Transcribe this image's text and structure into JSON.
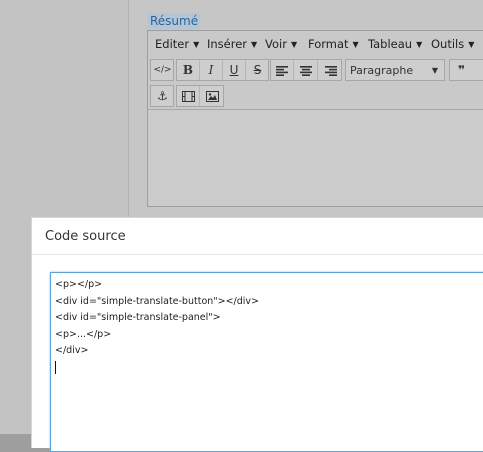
{
  "field": {
    "label": "Résumé"
  },
  "menubar": [
    {
      "label": "Editer",
      "icon": "caret-down"
    },
    {
      "label": "Insérer",
      "icon": "caret-down"
    },
    {
      "label": "Voir",
      "icon": "caret-down"
    },
    {
      "label": "Format",
      "icon": "caret-down"
    },
    {
      "label": "Tableau",
      "icon": "caret-down"
    },
    {
      "label": "Outils",
      "icon": "caret-down"
    }
  ],
  "toolbar": {
    "source_code_glyph": "</>",
    "bold_glyph": "B",
    "italic_glyph": "I",
    "underline_glyph": "U",
    "strikethrough_glyph": "S",
    "format_select": "Paragraphe",
    "blockquote_glyph": "❞",
    "anchor_glyph": "⚓",
    "media_glyph": "🎞",
    "image_glyph": "🖼"
  },
  "dialog": {
    "title": "Code source",
    "code_lines": [
      "<p></p>",
      "<div id=\"simple-translate-button\"></div>",
      "<div id=\"simple-translate-panel\">",
      "<p>...</p>",
      "</div>"
    ]
  }
}
